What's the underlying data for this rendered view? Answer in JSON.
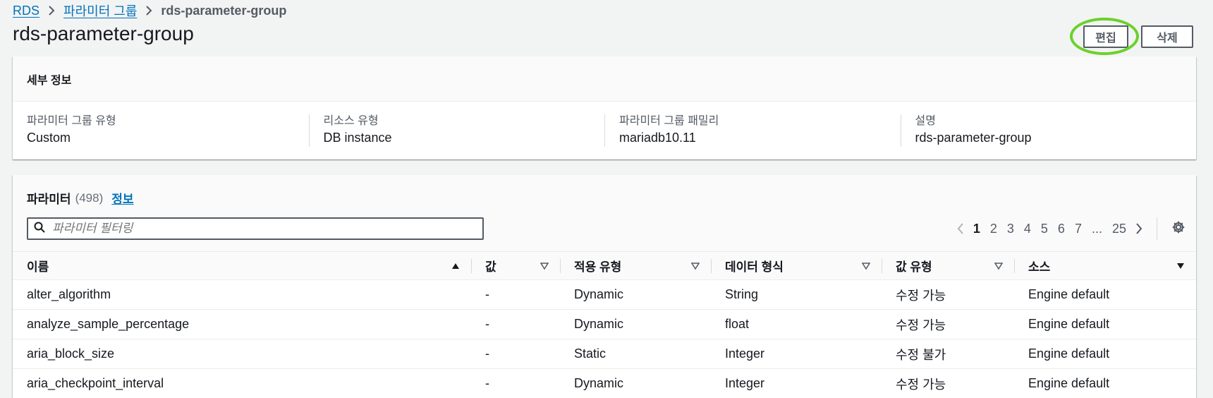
{
  "breadcrumb": {
    "root": "RDS",
    "parent": "파라미터 그룹",
    "current": "rds-parameter-group"
  },
  "page": {
    "title": "rds-parameter-group",
    "edit_label": "편집",
    "delete_label": "삭제"
  },
  "details": {
    "header": "세부 정보",
    "fields": [
      {
        "label": "파라미터 그룹 유형",
        "value": "Custom"
      },
      {
        "label": "리소스 유형",
        "value": "DB instance"
      },
      {
        "label": "파라미터 그룹 패밀리",
        "value": "mariadb10.11"
      },
      {
        "label": "설명",
        "value": "rds-parameter-group"
      }
    ]
  },
  "parameters": {
    "title": "파라미터",
    "count": "(498)",
    "info_link": "정보",
    "search_placeholder": "파라미터 필터링",
    "pagination": {
      "pages": [
        "1",
        "2",
        "3",
        "4",
        "5",
        "6",
        "7",
        "...",
        "25"
      ],
      "current": "1"
    },
    "columns": [
      "이름",
      "값",
      "적용 유형",
      "데이터 형식",
      "값 유형",
      "소스"
    ],
    "rows": [
      [
        "alter_algorithm",
        "-",
        "Dynamic",
        "String",
        "수정 가능",
        "Engine default"
      ],
      [
        "analyze_sample_percentage",
        "-",
        "Dynamic",
        "float",
        "수정 가능",
        "Engine default"
      ],
      [
        "aria_block_size",
        "-",
        "Static",
        "Integer",
        "수정 불가",
        "Engine default"
      ],
      [
        "aria_checkpoint_interval",
        "-",
        "Dynamic",
        "Integer",
        "수정 가능",
        "Engine default"
      ]
    ]
  },
  "colors": {
    "link": "#0073bb",
    "highlight_ring": "#6ad22a",
    "background": "#f2f3f3"
  }
}
